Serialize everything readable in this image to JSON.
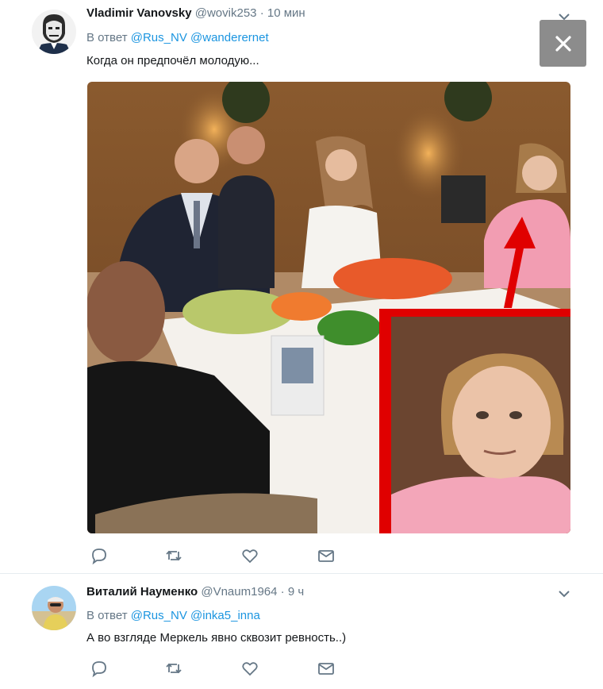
{
  "tweets": [
    {
      "name": "Vladimir Vanovsky",
      "handle": "@wovik253",
      "separator": "·",
      "time": "10 мин",
      "reply_prefix": "В ответ",
      "mentions": [
        "@Rus_NV",
        "@wanderernet"
      ],
      "text": "Когда он предпочёл молодую...",
      "has_photo": true
    },
    {
      "name": "Виталий Науменко",
      "handle": "@Vnaum1964",
      "separator": "·",
      "time": "9 ч",
      "reply_prefix": "В ответ",
      "mentions": [
        "@Rus_NV",
        "@inka5_inna"
      ],
      "text": "А во взгляде Меркель явно сквозит ревность..)"
    }
  ],
  "actions": [
    "reply-icon",
    "retweet-icon",
    "like-icon",
    "message-icon"
  ],
  "overlay": {
    "close_icon": "close-icon"
  },
  "colors": {
    "link": "#1b95e0",
    "muted": "#657786",
    "highlight": "#e00000",
    "overlay_button": "#8c8c8c"
  }
}
